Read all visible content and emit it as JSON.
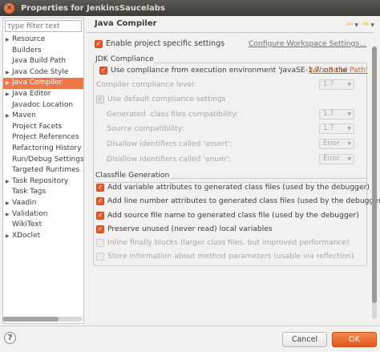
{
  "window": {
    "title": "Properties for JenkinsSaucelabs"
  },
  "filter": {
    "placeholder": "type filter text"
  },
  "tree": [
    {
      "label": "Resource",
      "expandable": true
    },
    {
      "label": "Builders",
      "expandable": false
    },
    {
      "label": "Java Build Path",
      "expandable": false
    },
    {
      "label": "Java Code Style",
      "expandable": true
    },
    {
      "label": "Java Compiler",
      "expandable": true,
      "selected": true
    },
    {
      "label": "Java Editor",
      "expandable": true
    },
    {
      "label": "Javadoc Location",
      "expandable": false
    },
    {
      "label": "Maven",
      "expandable": true
    },
    {
      "label": "Project Facets",
      "expandable": false
    },
    {
      "label": "Project References",
      "expandable": false
    },
    {
      "label": "Refactoring History",
      "expandable": false
    },
    {
      "label": "Run/Debug Settings",
      "expandable": false
    },
    {
      "label": "Targeted Runtimes",
      "expandable": false
    },
    {
      "label": "Task Repository",
      "expandable": true
    },
    {
      "label": "Task Tags",
      "expandable": false
    },
    {
      "label": "Vaadin",
      "expandable": true
    },
    {
      "label": "Validation",
      "expandable": true
    },
    {
      "label": "WikiText",
      "expandable": false
    },
    {
      "label": "XDoclet",
      "expandable": true
    }
  ],
  "page": {
    "title": "Java Compiler",
    "enable_specific": "Enable project specific settings",
    "configure_link": "Configure Workspace Settings..."
  },
  "jdk": {
    "group_label": "JDK Compliance",
    "use_compliance_prefix": "Use compliance from execution environment 'JavaSE-1.7' on the ",
    "use_compliance_link": "'Java Build Path'",
    "compliance_level_label": "Compiler compliance level:",
    "compliance_level_value": "1.7",
    "use_default": "Use default compliance settings",
    "generated_label": "Generated .class files compatibility:",
    "generated_value": "1.7",
    "source_label": "Source compatibility:",
    "source_value": "1.7",
    "assert_label": "Disallow identifiers called 'assert':",
    "assert_value": "Error",
    "enum_label": "Disallow identifiers called 'enum':",
    "enum_value": "Error"
  },
  "classfile": {
    "group_label": "Classfile Generation",
    "opt1": "Add variable attributes to generated class files (used by the debugger)",
    "opt2": "Add line number attributes to generated class files (used by the debugger)",
    "opt3": "Add source file name to generated class file (used by the debugger)",
    "opt4": "Preserve unused (never read) local variables",
    "opt5": "Inline finally blocks (larger class files, but improved performance)",
    "opt6": "Store information about method parameters (usable via reflection)"
  },
  "buttons": {
    "help": "?",
    "cancel": "Cancel",
    "ok": "OK"
  },
  "colors": {
    "accent": "#f07746",
    "title_bar": "#3c3b37",
    "link": "#d15d1a"
  }
}
